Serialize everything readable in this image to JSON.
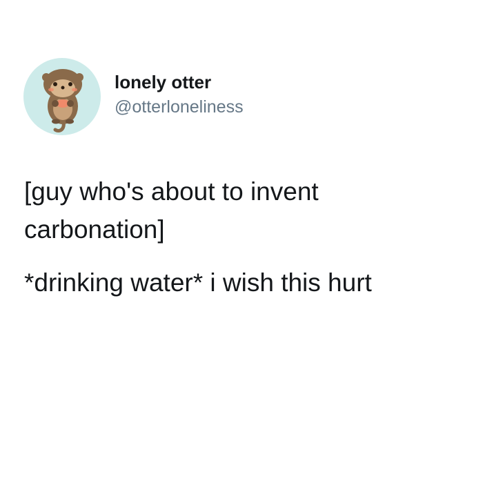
{
  "author": {
    "display_name": "lonely otter",
    "handle": "@otterloneliness",
    "avatar_icon": "otter-icon",
    "avatar_bg": "#cdebea"
  },
  "tweet": {
    "lines": [
      "[guy who's about to invent",
      "carbonation]",
      "*drinking water* i wish this hurt"
    ]
  },
  "colors": {
    "text": "#14171a",
    "secondary": "#657786",
    "otter_brown": "#8a6a4a",
    "cheek": "#f08a6a"
  }
}
